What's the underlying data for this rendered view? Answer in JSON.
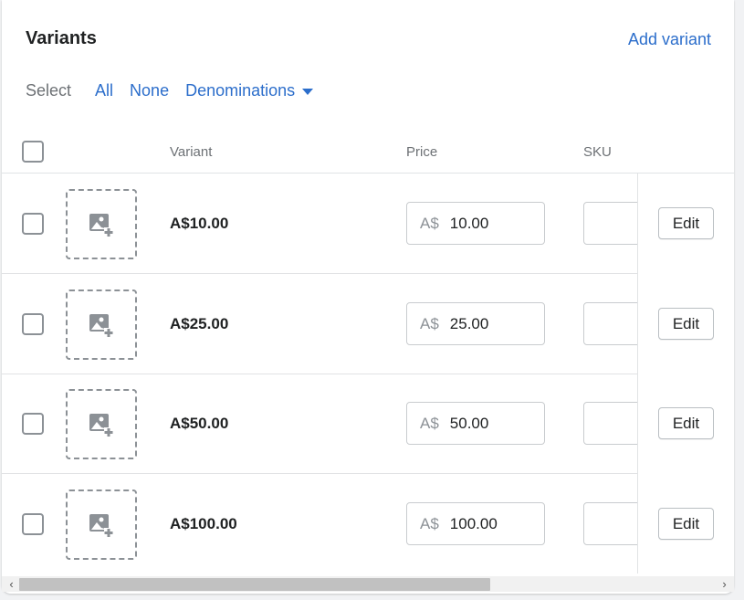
{
  "header": {
    "title": "Variants",
    "add_variant": "Add variant"
  },
  "select": {
    "label": "Select",
    "all": "All",
    "none": "None",
    "denominations": "Denominations"
  },
  "table": {
    "columns": {
      "variant": "Variant",
      "price": "Price",
      "sku": "SKU"
    },
    "rows": [
      {
        "name": "A$10.00",
        "currency": "A$",
        "price": "10.00",
        "sku": "",
        "edit": "Edit"
      },
      {
        "name": "A$25.00",
        "currency": "A$",
        "price": "25.00",
        "sku": "",
        "edit": "Edit"
      },
      {
        "name": "A$50.00",
        "currency": "A$",
        "price": "50.00",
        "sku": "",
        "edit": "Edit"
      },
      {
        "name": "A$100.00",
        "currency": "A$",
        "price": "100.00",
        "sku": "",
        "edit": "Edit"
      }
    ]
  },
  "icons": {
    "add_image": "image-add-icon",
    "dropdown": "caret-down-icon",
    "scroll_left": "chevron-left-icon",
    "scroll_right": "chevron-right-icon"
  },
  "colors": {
    "link": "#2c6ecb",
    "text": "#202223",
    "subdued": "#6d7175",
    "border": "#c9cccf"
  }
}
